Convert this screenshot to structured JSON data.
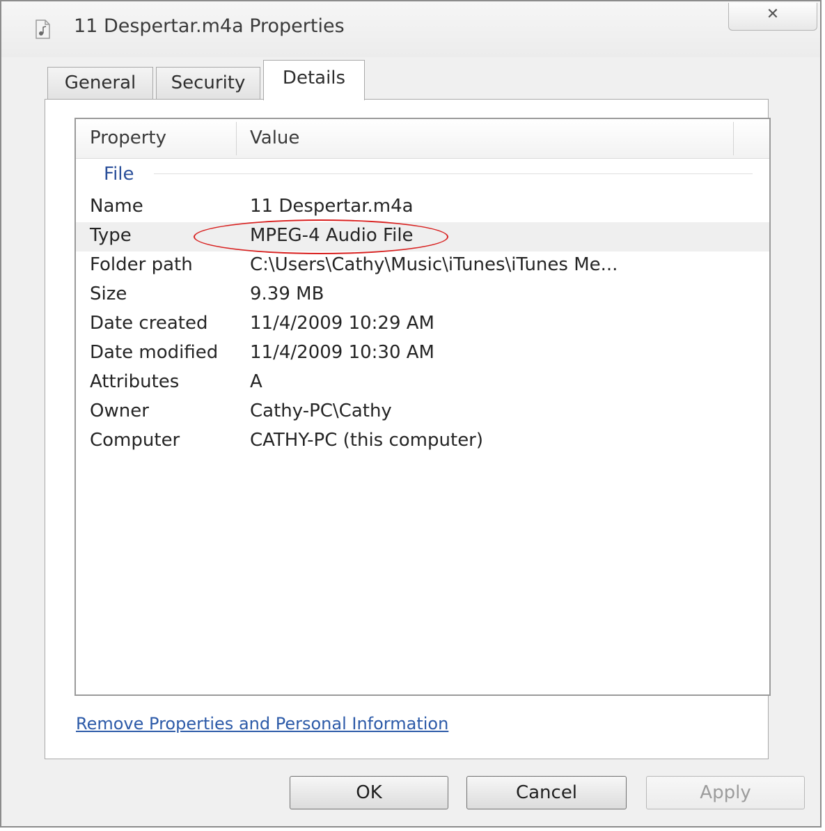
{
  "window": {
    "title": "11 Despertar.m4a Properties",
    "close_label": "✕"
  },
  "tabs": [
    {
      "label": "General"
    },
    {
      "label": "Security"
    },
    {
      "label": "Details",
      "active": true
    }
  ],
  "details": {
    "columns": {
      "property": "Property",
      "value": "Value"
    },
    "group": "File",
    "rows": [
      {
        "property": "Name",
        "value": "11 Despertar.m4a"
      },
      {
        "property": "Type",
        "value": "MPEG-4 Audio File",
        "highlighted": true
      },
      {
        "property": "Folder path",
        "value": "C:\\Users\\Cathy\\Music\\iTunes\\iTunes Me..."
      },
      {
        "property": "Size",
        "value": "9.39 MB"
      },
      {
        "property": "Date created",
        "value": "11/4/2009 10:29 AM"
      },
      {
        "property": "Date modified",
        "value": "11/4/2009 10:30 AM"
      },
      {
        "property": "Attributes",
        "value": "A"
      },
      {
        "property": "Owner",
        "value": "Cathy-PC\\Cathy"
      },
      {
        "property": "Computer",
        "value": "CATHY-PC (this computer)"
      }
    ],
    "remove_link": "Remove Properties and Personal Information"
  },
  "buttons": {
    "ok": "OK",
    "cancel": "Cancel",
    "apply": "Apply"
  },
  "colors": {
    "annotation": "#d8201f",
    "link": "#2c5aa8",
    "group_label": "#2a4f9a"
  },
  "icons": {
    "title": "audio-file-icon",
    "close": "close-icon"
  }
}
